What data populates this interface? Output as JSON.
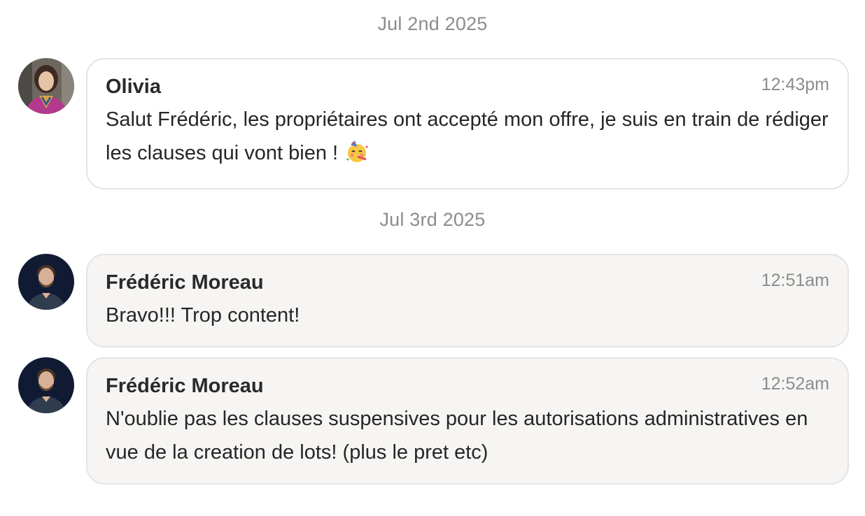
{
  "conversation": {
    "dates": [
      "Jul 2nd 2025",
      "Jul 3rd 2025"
    ],
    "messages": [
      {
        "author": "Olivia",
        "time": "12:43pm",
        "text": "Salut Frédéric, les propriétaires ont accepté mon offre, je suis en train de rédiger les clauses qui vont bien !",
        "emoji": "partying-face-emoji",
        "avatar": "olivia-avatar"
      },
      {
        "author": "Frédéric Moreau",
        "time": "12:51am",
        "text": "Bravo!!! Trop content!",
        "avatar": "frederic-avatar"
      },
      {
        "author": "Frédéric Moreau",
        "time": "12:52am",
        "text": "N'oublie pas les clauses suspensives pour les autorisations administratives en vue de la creation de lots! (plus le pret etc)",
        "avatar": "frederic-avatar"
      }
    ]
  },
  "colors": {
    "own_bubble_bg": "#ffffff",
    "other_bubble_bg": "#f6f5f3",
    "bubble_border": "#e4e4e4",
    "muted_text": "#8c8c8c"
  }
}
